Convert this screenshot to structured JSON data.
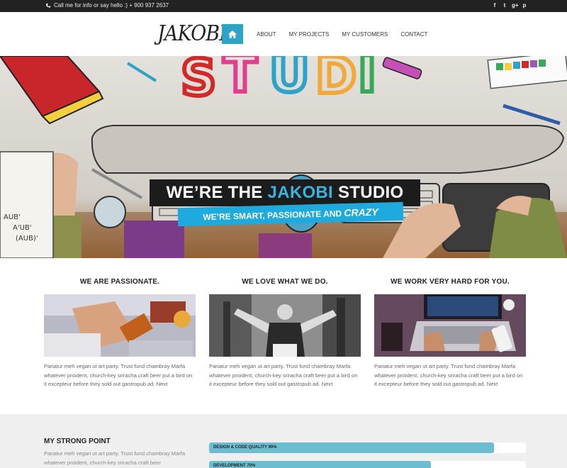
{
  "topbar": {
    "info": "Call me for info or say hello :) + 900 937 2637",
    "social": [
      "f",
      "t",
      "g+",
      "p"
    ],
    "social_icons": [
      "facebook-icon",
      "twitter-icon",
      "google-plus-icon",
      "pinterest-icon"
    ]
  },
  "header": {
    "logo": "JAKOBI",
    "nav": [
      "ABOUT",
      "MY PROJECTS",
      "MY CUSTOMERS",
      "CONTACT"
    ]
  },
  "hero": {
    "title_pre": "WE’RE THE ",
    "title_accent": "JAKOBI",
    "title_post": " STUDIO",
    "sub_pre": "WE’RE SMART, PASSIONATE AND ",
    "sub_accent": "CRAZY",
    "doodle_letters": [
      "S",
      "T",
      "U",
      "D",
      "I"
    ],
    "doodle_notes": [
      "AUB'",
      "A'UB'",
      "(AUB)'"
    ]
  },
  "features": [
    {
      "title": "WE ARE PASSIONATE.",
      "text": "Pariatur meh vegan ut art party. Trust fund chambray Marfa whatever proident, church-key sriracha craft beer put a bird on it excepteur before they sold out gastropub ad. Next"
    },
    {
      "title": "WE LOVE WHAT WE DO.",
      "text": "Pariatur meh vegan ut art party. Trust fund chambray Marfa whatever proident, church-key sriracha craft beer put a bird on it excepteur before they sold out gastropub ad. Next"
    },
    {
      "title": "WE WORK VERY HARD FOR YOU.",
      "text": "Pariatur meh vegan ut art party. Trust fund chambray Marfa whatever proident, church-key sriracha craft beer put a bird on it excepteur before they sold out gastropub ad. Next"
    }
  ],
  "strong_point": {
    "title": "MY STRONG POINT",
    "text": "Pariatur meh vegan ut art party. Trust fund chambray Marfa whatever proident, church-key sriracha craft beer",
    "skills": [
      {
        "label": "DESIGN & CODE QUALITY 90%",
        "value": 0.9
      },
      {
        "label": "DEVELOPMENT 70%",
        "value": 0.7
      }
    ]
  },
  "colors": {
    "accent": "#2ea3c8",
    "hero_blue": "#1eaadd",
    "bar": "#6cbdd0",
    "topbar": "#222222"
  }
}
